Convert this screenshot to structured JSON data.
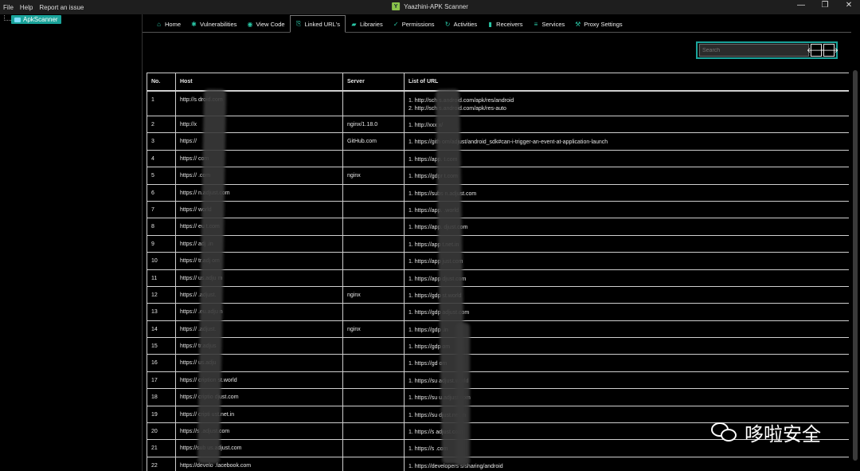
{
  "menu": [
    "File",
    "Help",
    "Report an issue"
  ],
  "window": {
    "title": "Yaazhini-APK Scanner",
    "icon_letter": "Y"
  },
  "tree": {
    "root_label": "ApkScanner"
  },
  "tabs": [
    {
      "label": "Home",
      "icon": "home-icon",
      "glyph": "⌂"
    },
    {
      "label": "Vulnerabilities",
      "icon": "bug-icon",
      "glyph": "✱"
    },
    {
      "label": "View Code",
      "icon": "eye-icon",
      "glyph": "◉"
    },
    {
      "label": "Linked URL's",
      "icon": "link-icon",
      "glyph": "⎘"
    },
    {
      "label": "Libraries",
      "icon": "folder-icon",
      "glyph": "▰"
    },
    {
      "label": "Permissions",
      "icon": "check-icon",
      "glyph": "✓"
    },
    {
      "label": "Activities",
      "icon": "refresh-icon",
      "glyph": "↻"
    },
    {
      "label": "Receivers",
      "icon": "signal-icon",
      "glyph": "▮"
    },
    {
      "label": "Services",
      "icon": "list-icon",
      "glyph": "≡"
    },
    {
      "label": "Proxy Settings",
      "icon": "wrench-icon",
      "glyph": "⚒"
    }
  ],
  "active_tab": "Linked URL's",
  "search": {
    "placeholder": "Search",
    "prev_glyph": "🡐",
    "next_glyph": "🡒"
  },
  "table": {
    "headers": [
      "No.",
      "Host",
      "Server",
      "List of URL"
    ],
    "rows": [
      {
        "no": "1",
        "host": "http://s        droid.com",
        "server": "",
        "urls": [
          "1. http://sch      s.android.com/apk/res/android",
          "2. http://sch      s.android.com/apk/res-auto"
        ]
      },
      {
        "no": "2",
        "host": "http://x",
        "server": "nginx/1.18.0",
        "urls": [
          "1. http://xxx        x/"
        ]
      },
      {
        "no": "3",
        "host": "https://",
        "server": "GitHub.com",
        "urls": [
          "1. https://gith        om/adjust/android_sdk#can-i-trigger-an-event-at-application-launch"
        ]
      },
      {
        "no": "4",
        "host": "https://        com",
        "server": "",
        "urls": [
          "1. https://app.        t.com"
        ]
      },
      {
        "no": "5",
        "host": "https://        .com",
        "server": "nginx",
        "urls": [
          "1. https://gdpr        t.com"
        ]
      },
      {
        "no": "6",
        "host": "https://        n.adjust.com",
        "server": "",
        "urls": [
          "1. https://subs        n.adjust.com"
        ]
      },
      {
        "no": "7",
        "host": "https://        world",
        "server": "",
        "urls": [
          "1. https://app.        .world"
        ]
      },
      {
        "no": "8",
        "host": "https://        eu        t.com",
        "server": "",
        "urls": [
          "1. https://app.        djust.com"
        ]
      },
      {
        "no": "9",
        "host": "https://        adj        .in",
        "server": "",
        "urls": [
          "1. https://app        t.net.in"
        ]
      },
      {
        "no": "10",
        "host": "https://        tr.adj        om",
        "server": "",
        "urls": [
          "1. https://app        just.com"
        ]
      },
      {
        "no": "11",
        "host": "https://        us.adju        m",
        "server": "",
        "urls": [
          "1. https://app        djust.com"
        ]
      },
      {
        "no": "12",
        "host": "https://        .adjust.",
        "server": "nginx",
        "urls": [
          "1. https://gdp        st.world"
        ]
      },
      {
        "no": "13",
        "host": "https://        .eu.adju        n",
        "server": "",
        "urls": [
          "1. https://gdp        adjust.com"
        ]
      },
      {
        "no": "14",
        "host": "https://        .adjust.",
        "server": "nginx",
        "urls": [
          "1. https://gdp        .in"
        ]
      },
      {
        "no": "15",
        "host": "https://        tr.adjus",
        "server": "",
        "urls": [
          "1. https://gdp        om"
        ]
      },
      {
        "no": "16",
        "host": "https://        us.adju",
        "server": "",
        "urls": [
          "1. https://gd        om"
        ]
      },
      {
        "no": "17",
        "host": "https://        cription        st.world",
        "server": "",
        "urls": [
          "1. https://su        adjust.world"
        ]
      },
      {
        "no": "18",
        "host": "https://        criptio        djust.com",
        "server": "",
        "urls": [
          "1. https://su        u.adjust.com"
        ]
      },
      {
        "no": "19",
        "host": "https://        cripti        ust.net.in",
        "server": "",
        "urls": [
          "1. https://su        djust.net.in"
        ]
      },
      {
        "no": "20",
        "host": "https://s        .adjust.com",
        "server": "",
        "urls": [
          "1. https://s        adjust.com"
        ]
      },
      {
        "no": "21",
        "host": "https://sub        us.adjust.com",
        "server": "",
        "urls": [
          "1. https://s        .com"
        ]
      },
      {
        "no": "22",
        "host": "https://develo        .facebook.com",
        "server": "",
        "urls": [
          "1. https://developers        s/sharing/android"
        ]
      }
    ]
  },
  "watermark": {
    "text": "哆啦安全"
  },
  "colors": {
    "accent": "#1aa39a",
    "tab_icon": "#29c7a6",
    "background": "#000000"
  }
}
